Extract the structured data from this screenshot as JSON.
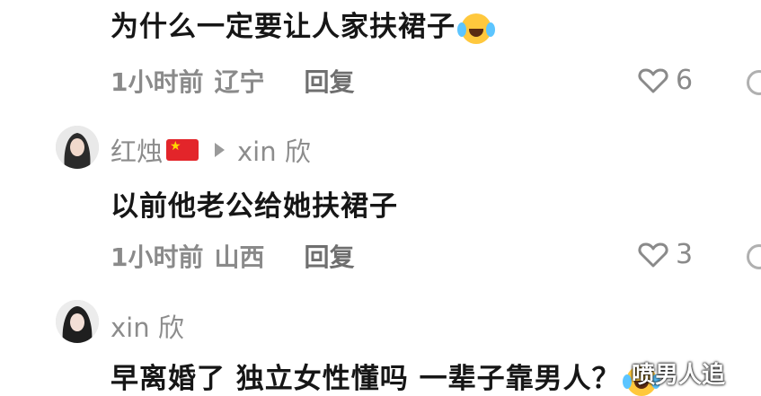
{
  "comments": [
    {
      "text": "为什么一定要让人家扶裙子",
      "emoji": "crying-laughing-emoji",
      "time": "1小时前",
      "location": "辽宁",
      "reply_label": "回复",
      "likes": "6"
    },
    {
      "username": "红烛",
      "flag": "china-flag",
      "reply_to": "xin 欣",
      "text": "以前他老公给她扶裙子",
      "time": "1小时前",
      "location": "山西",
      "reply_label": "回复",
      "likes": "3"
    },
    {
      "username": "xin 欣",
      "text": "早离婚了 独立女性懂吗 一辈子靠男人？",
      "emoji": "crying-laughing-emoji"
    }
  ],
  "watermark": "喷男人追",
  "colors": {
    "text": "#161616",
    "meta": "#8a8a8a",
    "background": "#ffffff"
  }
}
